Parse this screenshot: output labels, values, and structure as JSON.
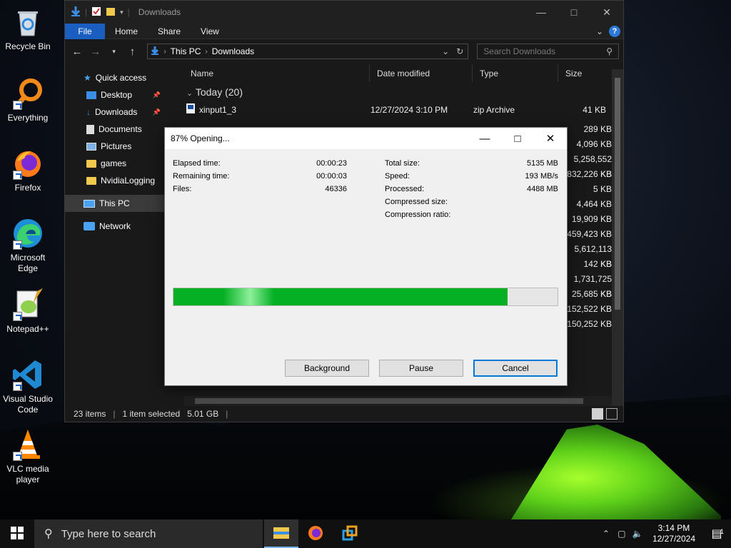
{
  "desktop": {
    "icons": [
      {
        "label": "Recycle Bin"
      },
      {
        "label": "Everything"
      },
      {
        "label": "Firefox"
      },
      {
        "label": "Microsoft Edge"
      },
      {
        "label": "Notepad++"
      },
      {
        "label": "Visual Studio Code"
      },
      {
        "label": "VLC media player"
      }
    ]
  },
  "explorer": {
    "title": "Downloads",
    "ribbon": {
      "file": "File",
      "home": "Home",
      "share": "Share",
      "view": "View"
    },
    "address": {
      "root": "This PC",
      "folder": "Downloads"
    },
    "search_placeholder": "Search Downloads",
    "sidebar": {
      "quick_access": "Quick access",
      "desktop": "Desktop",
      "downloads": "Downloads",
      "documents": "Documents",
      "pictures": "Pictures",
      "games": "games",
      "nvidia": "NvidiaLogging",
      "this_pc": "This PC",
      "network": "Network"
    },
    "columns": {
      "name": "Name",
      "date": "Date modified",
      "type": "Type",
      "size": "Size"
    },
    "group": "Today (20)",
    "first_row": {
      "name": "xinput1_3",
      "date": "12/27/2024 3:10 PM",
      "type": "zip Archive",
      "size": "41 KB"
    },
    "sizes": [
      "289 KB",
      "4,096 KB",
      "5,258,552 KB",
      "832,226 KB",
      "5 KB",
      "4,464 KB",
      "19,909 KB",
      "459,423 KB",
      "5,612,113 KB",
      "142 KB",
      "1,731,725 KB",
      "25,685 KB",
      "152,522 KB",
      "150,252 KB"
    ],
    "status": {
      "items": "23 items",
      "selected": "1 item selected",
      "size": "5.01 GB"
    }
  },
  "dialog": {
    "title": "87% Opening...",
    "progress_percent": 87,
    "elapsed_label": "Elapsed time:",
    "elapsed_value": "00:00:23",
    "remaining_label": "Remaining time:",
    "remaining_value": "00:00:03",
    "files_label": "Files:",
    "files_value": "46336",
    "total_label": "Total size:",
    "total_value": "5135 MB",
    "speed_label": "Speed:",
    "speed_value": "193 MB/s",
    "processed_label": "Processed:",
    "processed_value": "4488 MB",
    "compressed_label": "Compressed size:",
    "ratio_label": "Compression ratio:",
    "buttons": {
      "background": "Background",
      "pause": "Pause",
      "cancel": "Cancel"
    }
  },
  "taskbar": {
    "search_placeholder": "Type here to search",
    "time": "3:14 PM",
    "date": "12/27/2024",
    "notification_count": "1"
  },
  "colors": {
    "accent": "#1a5fbf",
    "progress": "#06b025"
  }
}
